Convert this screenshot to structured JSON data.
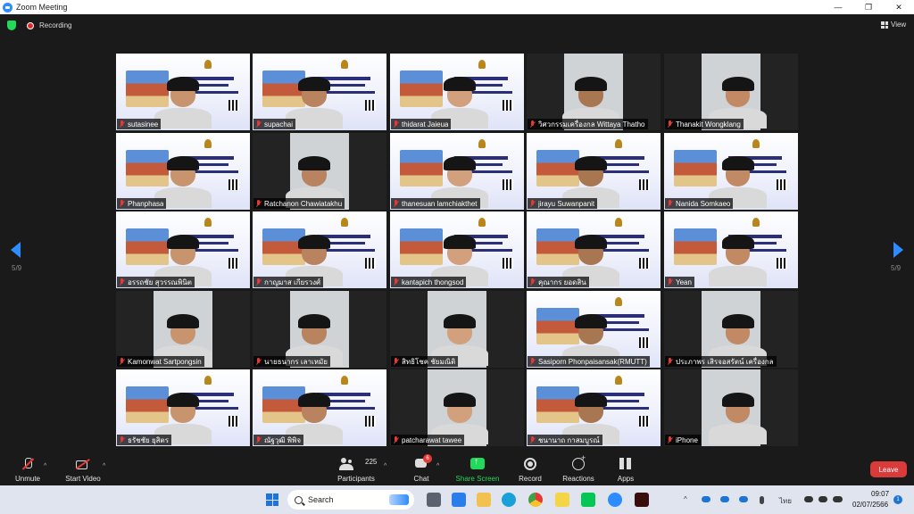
{
  "window": {
    "title": "Zoom Meeting",
    "controls": [
      "—",
      "❐",
      "✕"
    ]
  },
  "topbar": {
    "recording_label": "Recording",
    "view_label": "View"
  },
  "pager": {
    "left": "5/9",
    "right": "5/9"
  },
  "participants": [
    {
      "name": "sutasinee",
      "video": "slide"
    },
    {
      "name": "supachai",
      "video": "slide"
    },
    {
      "name": "thidarat Jaieua",
      "video": "slide"
    },
    {
      "name": "วิศวกรรมเครื่องกล Wittaya Thatho",
      "video": "camera"
    },
    {
      "name": "Thanakit Wongklang",
      "video": "camera"
    },
    {
      "name": "Phanphasa",
      "video": "slide"
    },
    {
      "name": "Ratchanon Chawiatakhu",
      "video": "camera"
    },
    {
      "name": "thanesuan lamchiakthet",
      "video": "slide"
    },
    {
      "name": "jirayu Suwanpanit",
      "video": "slide"
    },
    {
      "name": "Nanida Somkaeo",
      "video": "slide"
    },
    {
      "name": "อรรถชัย สุวรรณพินิต",
      "video": "slide"
    },
    {
      "name": "กาญมาส เกียรวงศ์",
      "video": "slide"
    },
    {
      "name": "kantapich thongsod",
      "video": "slide"
    },
    {
      "name": "คุณากร ยอดสิน",
      "video": "slide"
    },
    {
      "name": "Yean",
      "video": "slide"
    },
    {
      "name": "Kamonwat Sartpongsin",
      "video": "camera"
    },
    {
      "name": "นายธนากร เลาเหมัย",
      "video": "camera"
    },
    {
      "name": "สิทธิโชค ชัยมณิติ",
      "video": "camera"
    },
    {
      "name": "Sasiporn Phonpaisansak(RMUTT)",
      "video": "slide"
    },
    {
      "name": "ประภาพร เสิรจอสรัตน์ เครื่องกล",
      "video": "camera"
    },
    {
      "name": "ธรัชชัย ยุสิตร",
      "video": "slide"
    },
    {
      "name": "ณัฐวุฒิ พิพิจ",
      "video": "slide"
    },
    {
      "name": "patcharawat tawee",
      "video": "camera"
    },
    {
      "name": "ชนานาถ กาสมบูรณ์",
      "video": "slide"
    },
    {
      "name": "iPhone",
      "video": "camera"
    }
  ],
  "toolbar": {
    "unmute": "Unmute",
    "start_video": "Start Video",
    "participants_label": "Participants",
    "participants_count": "225",
    "chat_label": "Chat",
    "chat_badge": "6",
    "share_label": "Share Screen",
    "record_label": "Record",
    "reactions_label": "Reactions",
    "apps_label": "Apps",
    "leave_label": "Leave"
  },
  "taskbar": {
    "search_label": "Search",
    "language": "ไทย",
    "time": "09:07",
    "date": "02/07/2566",
    "notification_count": "1"
  },
  "colors": {
    "accent": "#2d8cff",
    "share_green": "#23d959",
    "leave_red": "#d93b3b",
    "muted_red": "#e53935"
  }
}
